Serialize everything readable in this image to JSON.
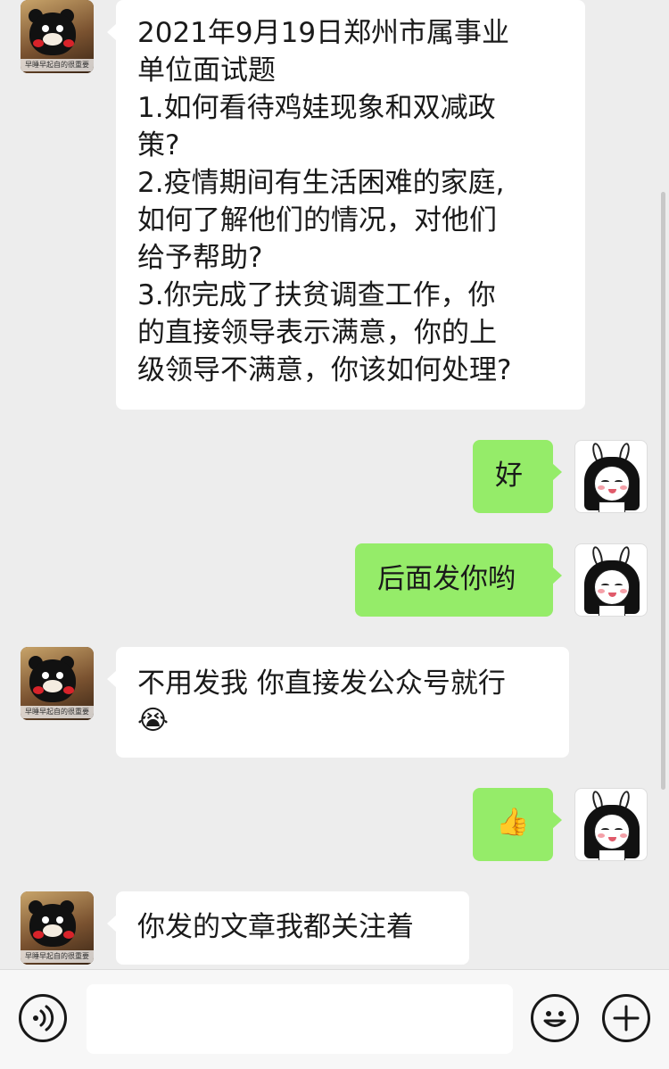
{
  "conversation": {
    "messages": [
      {
        "sender": "other",
        "lines": [
          "2021年9月19日郑州市属事业",
          "单位面试题",
          "1.如何看待鸡娃现象和双减政",
          "策?",
          "2.疫情期间有生活困难的家庭,",
          "如何了解他们的情况，对他们",
          "给予帮助?",
          "3.你完成了扶贫调查工作，你",
          "的直接领导表示满意，你的上",
          "级领导不满意，你该如何处理?"
        ]
      },
      {
        "sender": "me",
        "lines": [
          "好"
        ]
      },
      {
        "sender": "me",
        "lines": [
          "后面发你哟"
        ]
      },
      {
        "sender": "other",
        "lines": [
          "不用发我 你直接发公众号就行",
          "😭"
        ]
      },
      {
        "sender": "me",
        "lines": [
          "👍"
        ]
      },
      {
        "sender": "other",
        "lines": [
          "你发的文章我都关注着"
        ]
      }
    ]
  },
  "contact": {
    "avatar_caption": "早睡早起自的很重要"
  },
  "input_bar": {
    "voice_icon": "voice-icon",
    "emoji_icon": "emoji-icon",
    "more_icon": "plus-icon",
    "text_value": ""
  },
  "colors": {
    "chat_background": "#ededed",
    "incoming_bubble": "#ffffff",
    "outgoing_bubble": "#95ec69",
    "input_bar": "#f7f7f7"
  }
}
